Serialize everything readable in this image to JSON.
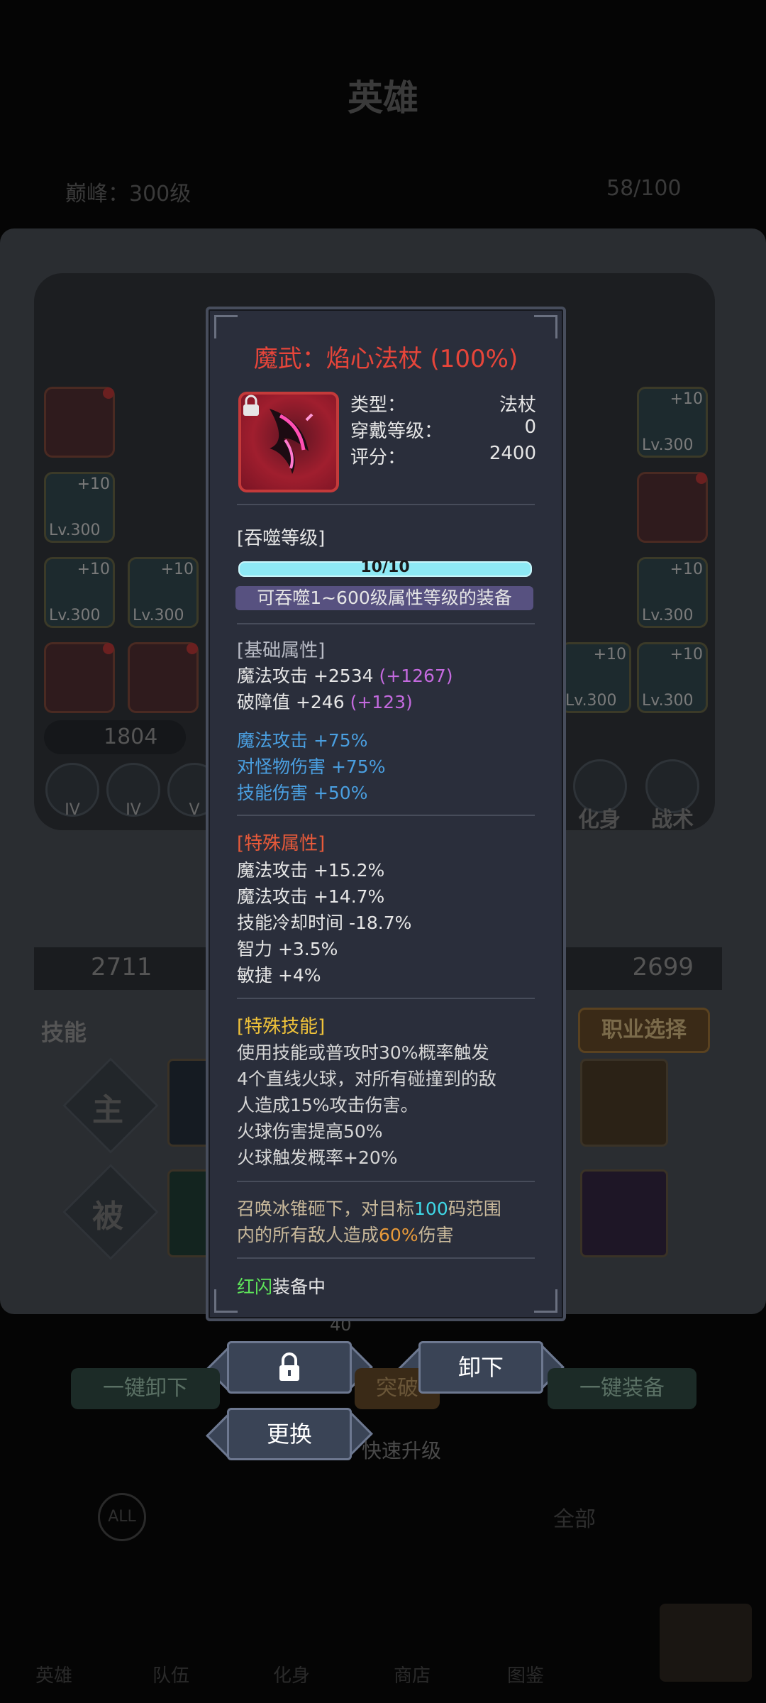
{
  "background": {
    "title": "英雄",
    "peak_label": "巅峰：300级",
    "slots_count": "58/100",
    "power_value": "1804",
    "hero_power_left": "2711",
    "hero_power_right": "2699",
    "round_icons": [
      "IV",
      "IV",
      "V"
    ],
    "side_labels": [
      "化身",
      "战术"
    ],
    "skills_label": "技能",
    "job_button": "职业选择",
    "active_label": "主",
    "passive_label": "被",
    "cost_value": "40",
    "one_key_unequip": "一键卸下",
    "breakthrough": "突破",
    "one_key_equip": "一键装备",
    "quick_upgrade": "快速升级",
    "filter_all": "ALL",
    "filter_text": "全部",
    "nav": [
      "英雄",
      "队伍",
      "化身",
      "商店",
      "图鉴"
    ],
    "left_slots": [
      {
        "plus": "",
        "lv": ""
      },
      {
        "plus": "+10",
        "lv": "Lv.300"
      },
      {
        "plus": "+10",
        "lv": "Lv.300"
      },
      {
        "plus": "+10",
        "lv": "Lv.300"
      },
      {
        "plus": "",
        "lv": ""
      },
      {
        "plus": "",
        "lv": ""
      }
    ],
    "right_slots": [
      {
        "plus": "+10",
        "lv": "Lv.300"
      },
      {
        "plus": "",
        "lv": ""
      },
      {
        "plus": "+10",
        "lv": "Lv.300"
      },
      {
        "plus": "+10",
        "lv": "Lv.300"
      },
      {
        "plus": "+10",
        "lv": "Lv.300"
      }
    ]
  },
  "popup": {
    "title": "魔武：焰心法杖 (100%)",
    "type_label": "类型：",
    "type_value": "法杖",
    "wear_label": "穿戴等级：",
    "wear_value": "0",
    "score_label": "评分：",
    "score_value": "2400",
    "devour_header": "[吞噬等级]",
    "devour_progress": 1.0,
    "devour_text": "10/10",
    "devour_note": "可吞噬1~600级属性等级的装备",
    "base_header": "[基础属性]",
    "base_lines": [
      {
        "text": "魔法攻击 +2534 ",
        "plus": "(+1267)"
      },
      {
        "text": "破障值 +246 ",
        "plus": "(+123)"
      }
    ],
    "blue_lines": [
      "魔法攻击 +75%",
      "对怪物伤害 +75%",
      "技能伤害 +50%"
    ],
    "special_attr_header": "[特殊属性]",
    "special_attrs": [
      "魔法攻击 +15.2%",
      "魔法攻击 +14.7%",
      "技能冷却时间 -18.7%",
      "智力 +3.5%",
      "敏捷 +4%"
    ],
    "special_skill_header": "[特殊技能]",
    "special_skill_lines": [
      "使用技能或普攻时30%概率触发",
      "4个直线火球，对所有碰撞到的敌",
      "人造成15%攻击伤害。",
      "火球伤害提高50%",
      "火球触发概率+20%"
    ],
    "set_line1_pre": "召唤冰锥砸下，对目标",
    "set_line1_num": "100",
    "set_line1_post": "码范围",
    "set_line2_pre": "内的所有敌人造成",
    "set_line2_num": "60%",
    "set_line2_post": "伤害",
    "equipped_name": "红闪",
    "equipped_suffix": "装备中"
  },
  "actions": {
    "unequip": "卸下",
    "replace": "更换"
  },
  "colors": {
    "title_red": "#e6453a",
    "plus_purple": "#c46adf",
    "attr_blue": "#4a9fe0",
    "special_red": "#e85a3a",
    "skill_yellow": "#f0c33a",
    "cyan": "#3fd7e6",
    "orange": "#e89a3a",
    "green": "#5ee45a"
  }
}
